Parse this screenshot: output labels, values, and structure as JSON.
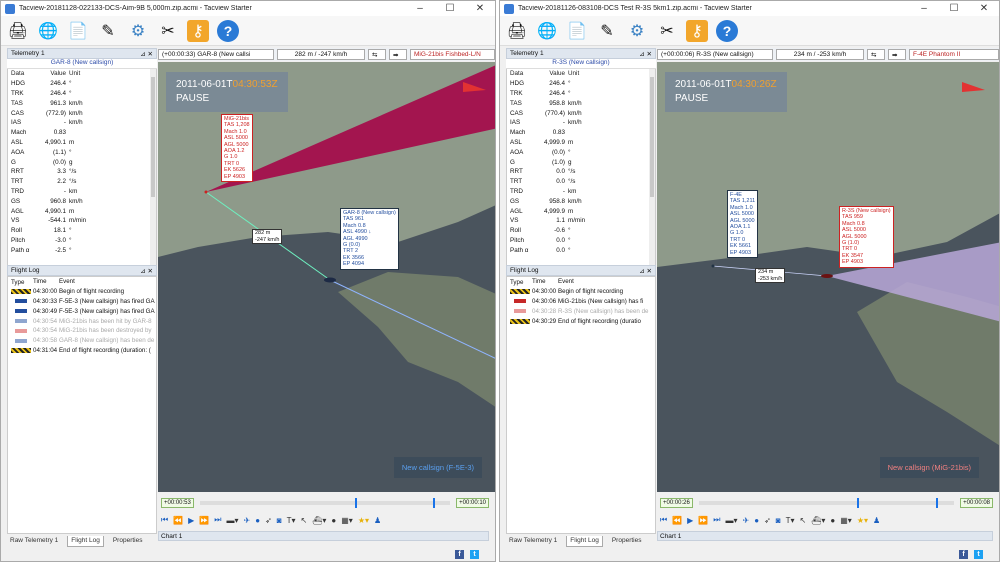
{
  "windows": [
    {
      "title": "Tacview-20181128-022133-DCS-Aim-9B 5,000m.zip.acmi - Tacview Starter",
      "telemetry_header": "Telemetry 1",
      "telemetry_object": "GAR-8 (New callsign)",
      "columns": [
        "Data",
        "Value",
        "Unit"
      ],
      "telemetry": [
        [
          "HDG",
          "246.4",
          "°"
        ],
        [
          "TRK",
          "246.4",
          "°"
        ],
        [
          "TAS",
          "961.3",
          "km/h"
        ],
        [
          "CAS",
          "(772.9)",
          "km/h"
        ],
        [
          "IAS",
          "-",
          "km/h"
        ],
        [
          "Mach",
          "0.83",
          ""
        ],
        [
          "ASL",
          "4,990.1",
          "m"
        ],
        [
          "AOA",
          "(1.1)",
          "°"
        ],
        [
          "G",
          "(0.0)",
          "g"
        ],
        [
          "RRT",
          "3.3",
          "°/s"
        ],
        [
          "TRT",
          "2.2",
          "°/s"
        ],
        [
          "TRD",
          "-",
          "km"
        ],
        [
          "GS",
          "960.8",
          "km/h"
        ],
        [
          "AGL",
          "4,990.1",
          "m"
        ],
        [
          "VS",
          "-544.1",
          "m/min"
        ],
        [
          "Roll",
          "18.1",
          "°"
        ],
        [
          "Pitch",
          "-3.0",
          "°"
        ],
        [
          "Path α",
          "-2.5",
          "°"
        ]
      ],
      "flog_header": "Flight Log",
      "flog_columns": [
        "Type",
        "Time",
        "Event"
      ],
      "flog": [
        {
          "icon": "stripe",
          "time": "04:30:00",
          "event": "Begin of flight recording",
          "fade": false
        },
        {
          "icon": "blue",
          "time": "04:30:33",
          "event": "F-5E-3 (New callsign) has fired GA",
          "fade": false
        },
        {
          "icon": "blue",
          "time": "04:30:49",
          "event": "F-5E-3 (New callsign) has fired GA",
          "fade": false
        },
        {
          "icon": "fblue",
          "time": "04:30:54",
          "event": "MiG-21bis has been hit by GAR-8",
          "fade": true
        },
        {
          "icon": "fred",
          "time": "04:30:54",
          "event": "MiG-21bis has been destroyed by",
          "fade": true
        },
        {
          "icon": "fblue",
          "time": "04:30:58",
          "event": "GAR-8 (New callsign) has been de",
          "fade": true
        },
        {
          "icon": "stripe",
          "time": "04:31:04",
          "event": "End of flight recording (duration: (",
          "fade": false
        }
      ],
      "tabs": [
        "Raw Telemetry 1",
        "Flight Log",
        "Properties"
      ],
      "view": {
        "time_label": "(+00:00:33) GAR-8 (New callsi",
        "dist_label": "282 m / -247 km/h",
        "target_label": "MiG-21bis Fishbed-L/N",
        "clock_prefix": "2011-06-01T",
        "clock_time": "04:30:53Z",
        "status": "PAUSE",
        "red_tag": [
          "MiG-21bis",
          "TAS 1,208",
          "Mach 1.0",
          "ASL 5000",
          "AGL 5000",
          "AOA 1.2",
          "G 1.0",
          "TRT 0",
          "EK 5626",
          "EP 4903"
        ],
        "blue_tag": [
          "GAR-8 (New callsign)",
          "TAS 961",
          "Mach 0.8",
          "ASL 4990 ↓",
          "AGL 4990",
          "G (0.0)",
          "TRT 2",
          "EK 3566",
          "EP 4094"
        ],
        "dist_tag": [
          "282 m",
          "-247 km/h"
        ],
        "callsign": "New callsign (F-5E-3)",
        "t_start": "+00:00:53",
        "t_end": "+00:00:10",
        "chart": "Chart 1",
        "callsign_color": "#5aa0f0"
      }
    },
    {
      "title": "Tacview-20181126-083108-DCS Test R-3S 5km1.zip.acmi - Tacview Starter",
      "telemetry_header": "Telemetry 1",
      "telemetry_object": "R-3S (New callsign)",
      "columns": [
        "Data",
        "Value",
        "Unit"
      ],
      "telemetry": [
        [
          "HDG",
          "246.4",
          "°"
        ],
        [
          "TRK",
          "246.4",
          "°"
        ],
        [
          "TAS",
          "958.8",
          "km/h"
        ],
        [
          "CAS",
          "(770.4)",
          "km/h"
        ],
        [
          "IAS",
          "-",
          "km/h"
        ],
        [
          "Mach",
          "0.83",
          ""
        ],
        [
          "ASL",
          "4,999.9",
          "m"
        ],
        [
          "AOA",
          "(0.0)",
          "°"
        ],
        [
          "G",
          "(1.0)",
          "g"
        ],
        [
          "RRT",
          "0.0",
          "°/s"
        ],
        [
          "TRT",
          "0.0",
          "°/s"
        ],
        [
          "TRD",
          "-",
          "km"
        ],
        [
          "GS",
          "958.8",
          "km/h"
        ],
        [
          "AGL",
          "4,999.9",
          "m"
        ],
        [
          "VS",
          "1.1",
          "m/min"
        ],
        [
          "Roll",
          "-0.6",
          "°"
        ],
        [
          "Pitch",
          "0.0",
          "°"
        ],
        [
          "Path α",
          "0.0",
          "°"
        ]
      ],
      "flog_header": "Flight Log",
      "flog_columns": [
        "Type",
        "Time",
        "Event"
      ],
      "flog": [
        {
          "icon": "stripe",
          "time": "04:30:00",
          "event": "Begin of flight recording",
          "fade": false
        },
        {
          "icon": "red",
          "time": "04:30:06",
          "event": "MiG-21bis (New callsign) has fi",
          "fade": false
        },
        {
          "icon": "fred",
          "time": "04:30:28",
          "event": "R-3S (New callsign) has been de",
          "fade": true
        },
        {
          "icon": "stripe",
          "time": "04:30:29",
          "event": "End of flight recording (duratio",
          "fade": false
        }
      ],
      "tabs": [
        "Raw Telemetry 1",
        "Flight Log",
        "Properties"
      ],
      "view": {
        "time_label": "(+00:00:06) R-3S (New callsign)",
        "dist_label": "234 m / -253 km/h",
        "target_label": "F-4E Phantom II",
        "clock_prefix": "2011-06-01T",
        "clock_time": "04:30:26Z",
        "status": "PAUSE",
        "red_tag": [
          "R-3S (New callsign)",
          "TAS 959",
          "Mach 0.8",
          "ASL 5000",
          "AGL 5000",
          "G (1.0)",
          "TRT 0",
          "EK 3547",
          "EP 4903"
        ],
        "blue_tag": [
          "F-4E",
          "TAS 1,211",
          "Mach 1.0",
          "ASL 5000",
          "AGL 5000",
          "AOA 1.1",
          "G 1.0",
          "TRT 0",
          "EK 5661",
          "EP 4903"
        ],
        "dist_tag": [
          "234 m",
          "-253 km/h"
        ],
        "callsign": "New callsign (MiG-21bis)",
        "t_start": "+00:00:26",
        "t_end": "+00:00:08",
        "chart": "Chart 1",
        "callsign_color": "#f08080"
      }
    }
  ],
  "icons": [
    "print-icon",
    "globe-icon",
    "document-icon",
    "edit-icon",
    "gear-icon",
    "tools-icon",
    "key-icon",
    "help-icon"
  ]
}
